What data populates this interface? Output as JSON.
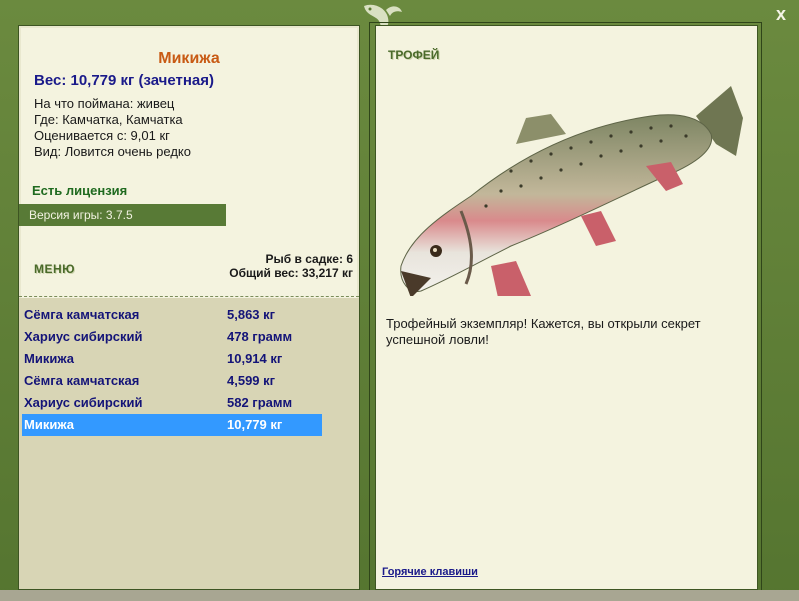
{
  "window": {
    "close_label": "x"
  },
  "fish": {
    "name": "Микижа",
    "weight": "Вес: 10,779 кг (зачетная)",
    "caught_on": "На что поймана: живец",
    "where": "Где: Камчатка, Камчатка",
    "price": "Оценивается с: 9,01 кг",
    "rarity": "Вид: Ловится очень редко"
  },
  "license": "Есть лицензия",
  "version": "Версия игры: 3.7.5",
  "menu_label": "МЕНЮ",
  "cage": {
    "count": "Рыб в садке: 6",
    "total": "Общий вес: 33,217 кг"
  },
  "catches": [
    {
      "name": "Сёмга камчатская",
      "weight": "5,863 кг"
    },
    {
      "name": "Хариус сибирский",
      "weight": "478 грамм"
    },
    {
      "name": "Микижа",
      "weight": "10,914 кг"
    },
    {
      "name": "Сёмга камчатская",
      "weight": "4,599 кг"
    },
    {
      "name": "Хариус сибирский",
      "weight": "582 грамм"
    },
    {
      "name": "Микижа",
      "weight": "10,779 кг"
    }
  ],
  "trophy": {
    "label": "ТРОФЕЙ",
    "text": "Трофейный экземпляр! Кажется, вы открыли секрет успешной ловли!",
    "image_icon": "rainbow-trout-image"
  },
  "hotkeys": "Горячие клавиши",
  "colors": {
    "frame": "#5a7a32",
    "panel": "#f4f3df",
    "selected": "#3399ff",
    "fish_name": "#c85a14"
  }
}
